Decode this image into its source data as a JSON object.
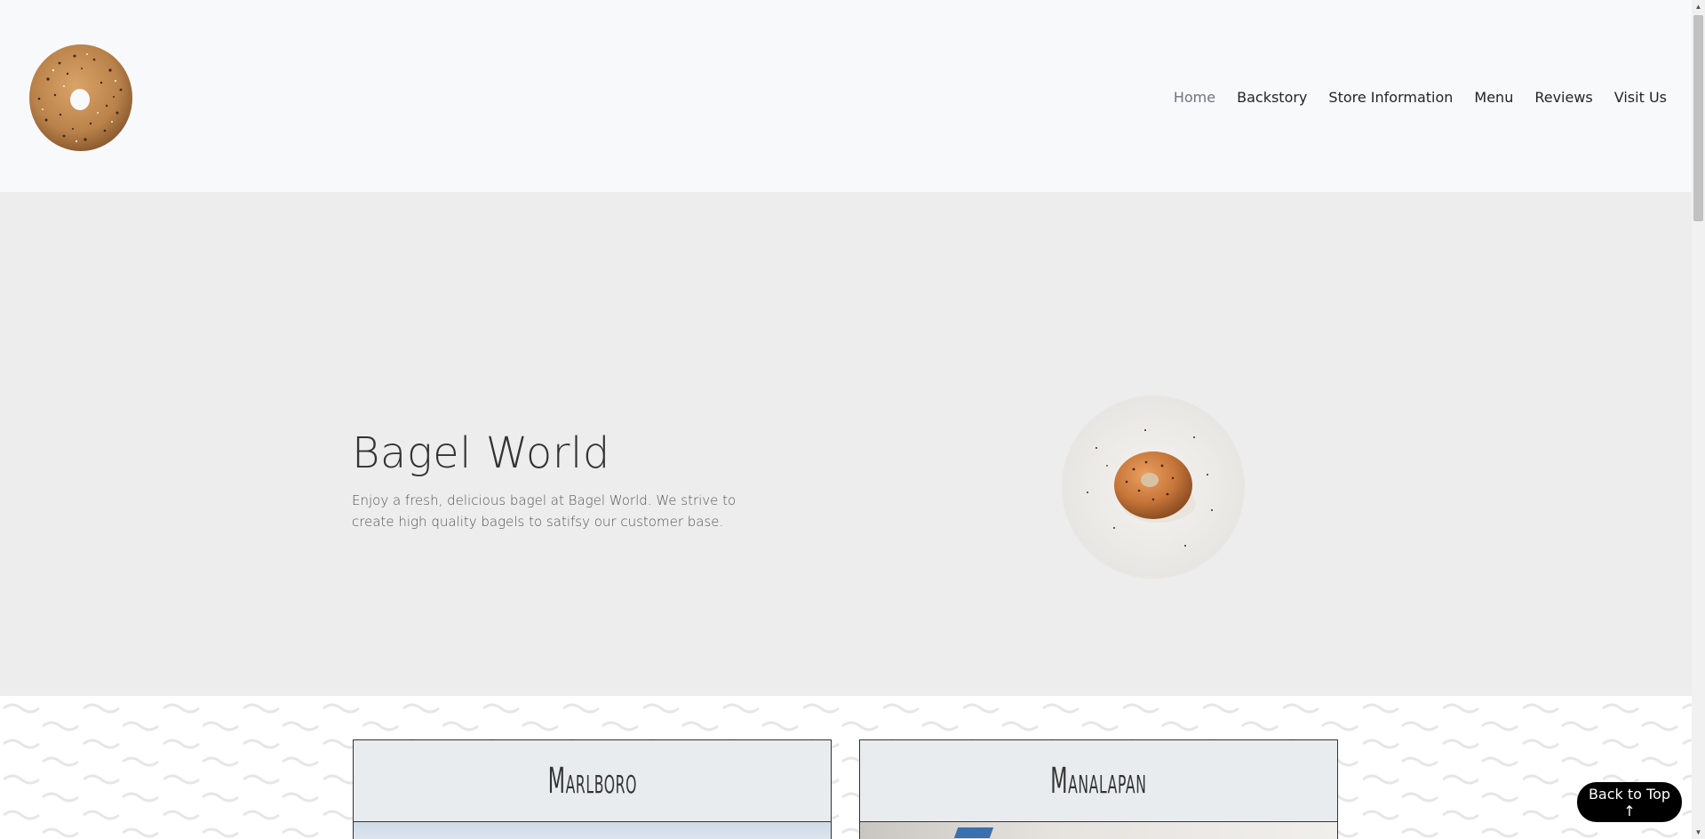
{
  "header": {
    "logo_icon": "bagel-icon",
    "nav": [
      {
        "label": "Home",
        "active": true
      },
      {
        "label": "Backstory",
        "active": false
      },
      {
        "label": "Store Information",
        "active": false
      },
      {
        "label": "Menu",
        "active": false
      },
      {
        "label": "Reviews",
        "active": false
      },
      {
        "label": "Visit Us",
        "active": false
      }
    ]
  },
  "hero": {
    "title": "Bagel World",
    "text": "Enjoy a fresh, delicious bagel at Bagel World. We strive to create high quality bagels to satifsy our customer base.",
    "image_icon": "bagel-sandwich-icon"
  },
  "locations": [
    {
      "name": "Marlboro"
    },
    {
      "name": "Manalapan"
    }
  ],
  "back_to_top": {
    "label": "Back to Top ↑"
  },
  "colors": {
    "header_bg": "#f8f9fa",
    "hero_bg": "#ededed",
    "card_head_bg": "#e9ecef",
    "active_nav": "#6c757d",
    "button_bg": "#000000"
  }
}
